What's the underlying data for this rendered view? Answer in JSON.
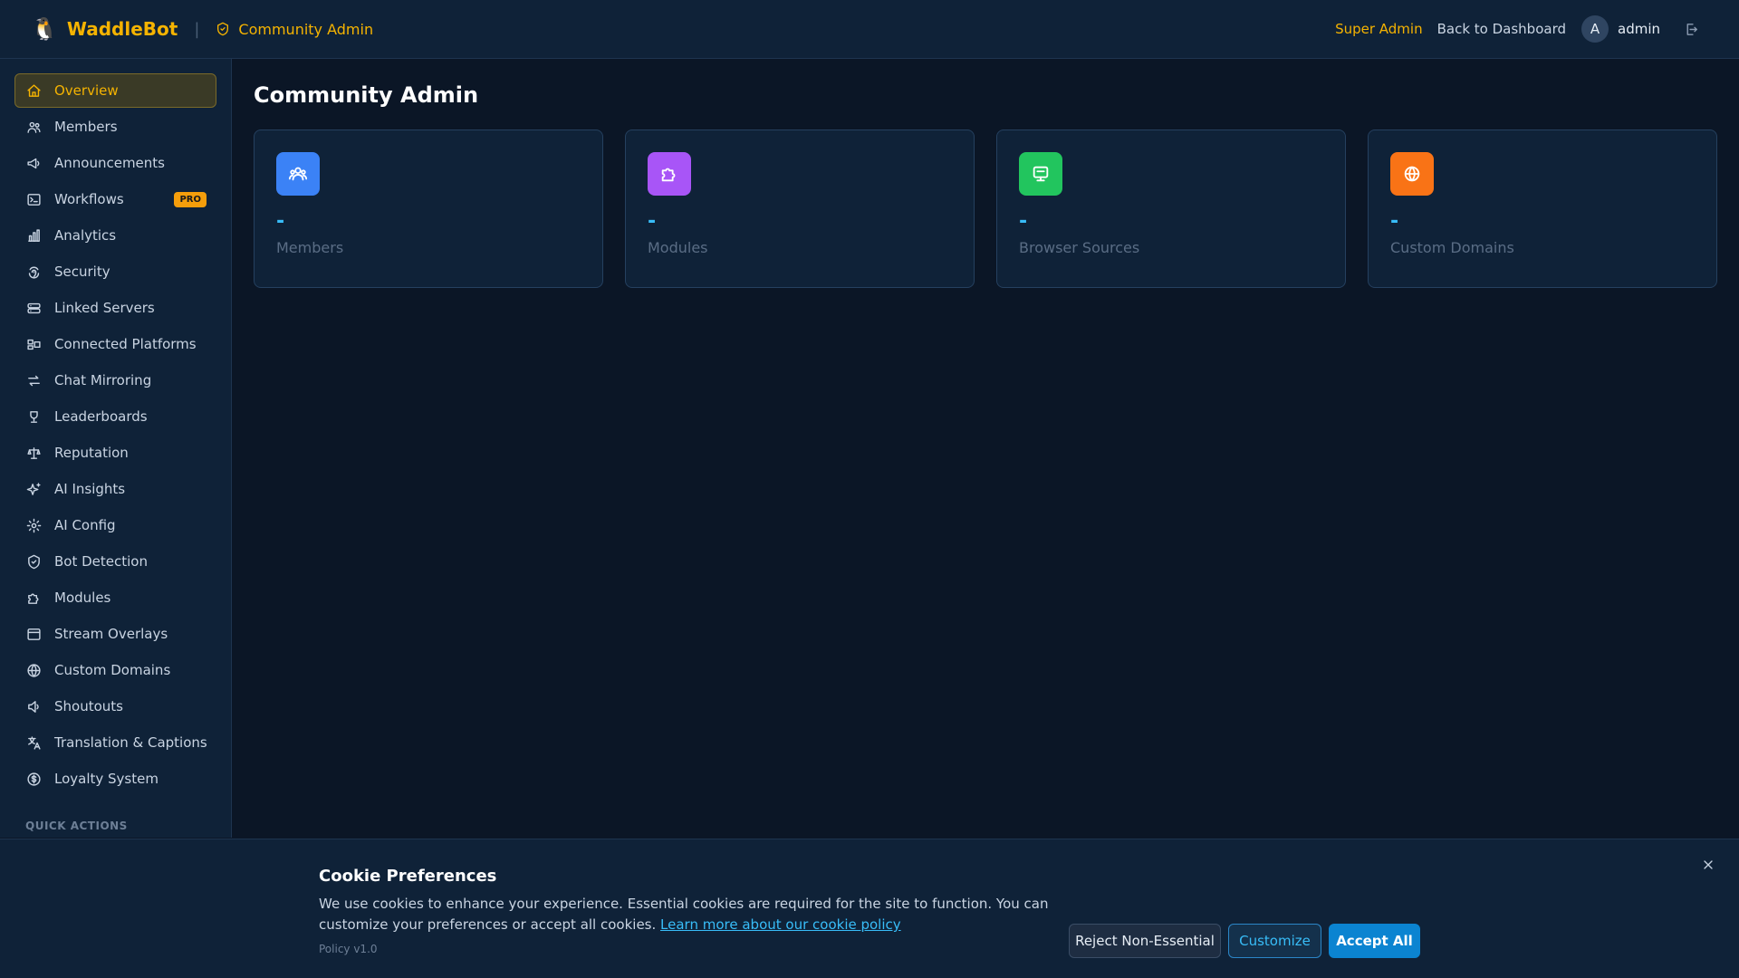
{
  "header": {
    "brand_name": "WaddleBot",
    "brand_logo": "🐧",
    "breadcrumb": "Community Admin",
    "super_admin": "Super Admin",
    "back_link": "Back to Dashboard",
    "avatar_initial": "A",
    "user_name": "admin"
  },
  "sidebar": {
    "items": [
      {
        "label": "Overview",
        "icon": "home-icon",
        "active": true
      },
      {
        "label": "Members",
        "icon": "users-icon"
      },
      {
        "label": "Announcements",
        "icon": "megaphone-icon"
      },
      {
        "label": "Workflows",
        "icon": "terminal-icon",
        "badge": "PRO"
      },
      {
        "label": "Analytics",
        "icon": "bar-chart-icon"
      },
      {
        "label": "Security",
        "icon": "fingerprint-icon"
      },
      {
        "label": "Linked Servers",
        "icon": "server-icon"
      },
      {
        "label": "Connected Platforms",
        "icon": "platforms-icon"
      },
      {
        "label": "Chat Mirroring",
        "icon": "arrows-icon"
      },
      {
        "label": "Leaderboards",
        "icon": "trophy-icon"
      },
      {
        "label": "Reputation",
        "icon": "scale-icon"
      },
      {
        "label": "AI Insights",
        "icon": "sparkles-icon"
      },
      {
        "label": "AI Config",
        "icon": "gear-icon"
      },
      {
        "label": "Bot Detection",
        "icon": "shield-icon"
      },
      {
        "label": "Modules",
        "icon": "puzzle-icon"
      },
      {
        "label": "Stream Overlays",
        "icon": "window-icon"
      },
      {
        "label": "Custom Domains",
        "icon": "globe-icon"
      },
      {
        "label": "Shoutouts",
        "icon": "speaker-icon"
      },
      {
        "label": "Translation & Captions",
        "icon": "translate-icon"
      },
      {
        "label": "Loyalty System",
        "icon": "coin-icon"
      }
    ],
    "quick_actions_heading": "QUICK ACTIONS"
  },
  "main": {
    "title": "Community Admin",
    "cards": [
      {
        "value": "-",
        "label": "Members",
        "icon": "users-icon",
        "color": "#3b82f6"
      },
      {
        "value": "-",
        "label": "Modules",
        "icon": "puzzle-icon",
        "color": "#a855f7"
      },
      {
        "value": "-",
        "label": "Browser Sources",
        "icon": "monitor-icon",
        "color": "#22c55e"
      },
      {
        "value": "-",
        "label": "Custom Domains",
        "icon": "globe-icon",
        "color": "#f97316"
      }
    ]
  },
  "cookie": {
    "title": "Cookie Preferences",
    "text": "We use cookies to enhance your experience. Essential cookies are required for the site to function. You can customize your preferences or accept all cookies.",
    "link": "Learn more about our cookie policy",
    "policy_version": "Policy v1.0",
    "reject_label": "Reject Non-Essential",
    "customize_label": "Customize",
    "accept_label": "Accept All"
  },
  "colors": {
    "accent": "#f5b301",
    "link": "#38bdf8",
    "primary_button": "#0b84d1"
  }
}
